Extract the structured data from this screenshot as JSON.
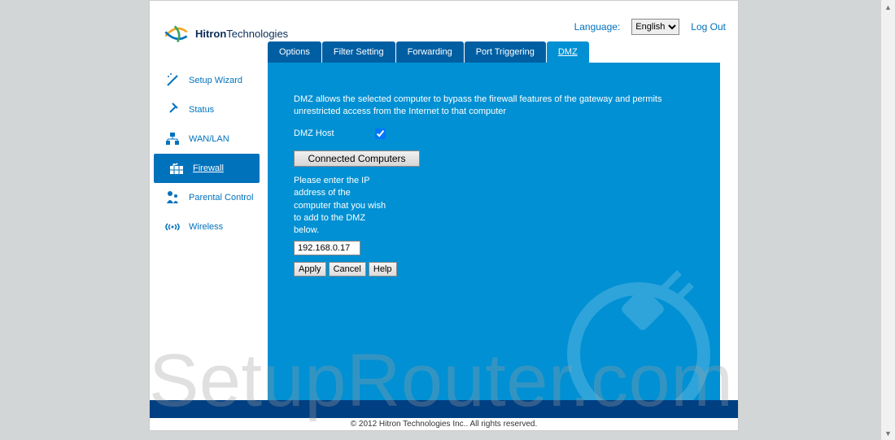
{
  "brand": {
    "bold": "Hitron",
    "rest": "Technologies"
  },
  "language": {
    "label": "Language:",
    "selected": "English"
  },
  "logout": "Log Out",
  "sidebar": {
    "items": [
      {
        "label": "Setup Wizard"
      },
      {
        "label": "Status"
      },
      {
        "label": "WAN/LAN"
      },
      {
        "label": "Firewall"
      },
      {
        "label": "Parental Control"
      },
      {
        "label": "Wireless"
      }
    ]
  },
  "tabs": [
    {
      "label": "Options"
    },
    {
      "label": "Filter Setting"
    },
    {
      "label": "Forwarding"
    },
    {
      "label": "Port Triggering"
    },
    {
      "label": "DMZ"
    }
  ],
  "main": {
    "description": "DMZ allows the selected computer to bypass the firewall features of the gateway and permits unrestricted access from the Internet to that computer",
    "dmz_host_label": "DMZ Host",
    "dmz_host_checked": true,
    "connected_btn": "Connected Computers",
    "prompt": "Please enter the IP address of the computer that you wish to add to the DMZ below.",
    "ip_value": "192.168.0.17",
    "apply": "Apply",
    "cancel": "Cancel",
    "help": "Help"
  },
  "footer": "© 2012 Hitron Technologies Inc.. All rights reserved.",
  "watermark": "SetupRouter.com"
}
